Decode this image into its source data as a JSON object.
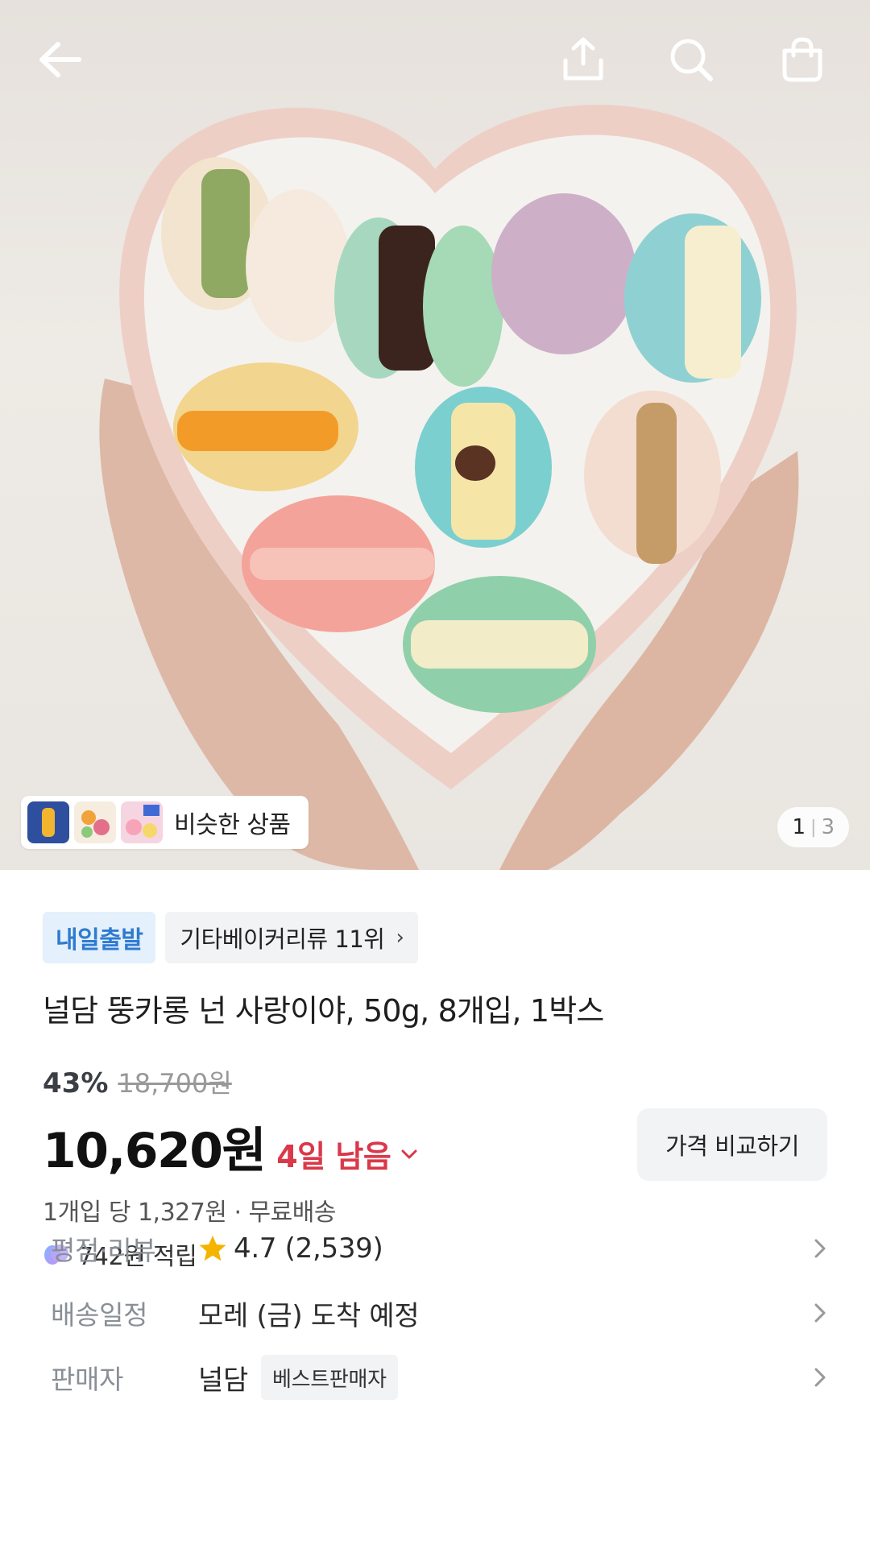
{
  "hero": {
    "similar_label": "비슷한 상품",
    "pager": {
      "current": "1",
      "separator": "|",
      "total": "3"
    }
  },
  "topbar": {
    "icons": [
      "back-arrow-icon",
      "share-icon",
      "search-icon",
      "cart-icon"
    ]
  },
  "badges": {
    "shipping": "내일출발",
    "ranking": "기타베이커리류 11위",
    "ranking_chevron": "›"
  },
  "product": {
    "title": "널담 뚱카롱 넌 사랑이야, 50g, 8개입, 1박스",
    "discount": "43%",
    "original_price": "18,700원",
    "price": "10,620원",
    "remaining": "4일 남음",
    "compare_button": "가격 비교하기",
    "unit_info": "1개입 당 1,327원 · 무료배송",
    "points": "742원 적립"
  },
  "details": {
    "rating_label": "평점·리뷰",
    "rating_value": "4.7 (2,539)",
    "delivery_label": "배송일정",
    "delivery_value": "모레 (금) 도착 예정",
    "seller_label": "판매자",
    "seller_name": "널담",
    "seller_badge": "베스트판매자"
  },
  "colors": {
    "accent_red": "#d9394a",
    "badge_blue_text": "#2e7bd1",
    "badge_blue_bg": "#e4f0fb",
    "star": "#f5b400"
  }
}
